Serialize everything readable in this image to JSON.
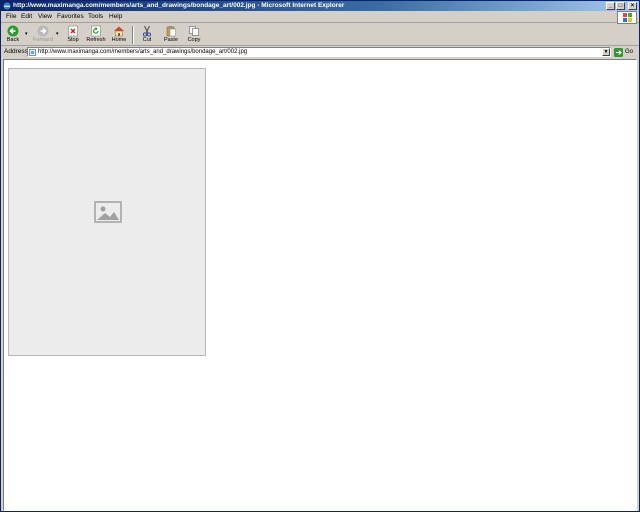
{
  "window": {
    "title": "http://www.maximanga.com/members/arts_and_drawings/bondage_art/002.jpg - Microsoft Internet Explorer"
  },
  "menu": {
    "items": [
      {
        "label": "File"
      },
      {
        "label": "Edit"
      },
      {
        "label": "View"
      },
      {
        "label": "Favorites"
      },
      {
        "label": "Tools"
      },
      {
        "label": "Help"
      }
    ]
  },
  "toolbar": {
    "back": "Back",
    "forward": "Forward",
    "stop": "Stop",
    "refresh": "Refresh",
    "home": "Home",
    "cut": "Cut",
    "paste": "Paste",
    "copy": "Copy"
  },
  "address": {
    "label": "Address",
    "url": "http://www.maximanga.com/members/arts_and_drawings/bondage_art/002.jpg",
    "go": "Go"
  },
  "colors": {
    "titlebar_start": "#0a246a",
    "titlebar_end": "#a6caf0",
    "chrome": "#d4d0c8",
    "go_green": "#2e9a2e"
  },
  "icons": {
    "back": "back-arrow-icon",
    "forward": "forward-arrow-icon",
    "stop": "stop-icon",
    "refresh": "refresh-icon",
    "home": "home-icon",
    "cut": "scissors-icon",
    "paste": "clipboard-icon",
    "copy": "copy-icon",
    "go": "go-arrow-icon",
    "throbber": "windows-logo-icon"
  }
}
